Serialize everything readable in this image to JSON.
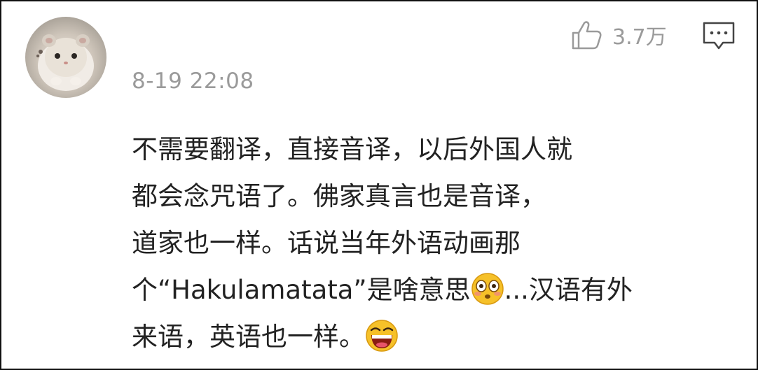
{
  "comment": {
    "timestamp": "8-19 22:08",
    "like_count": "3.7万",
    "icons": {
      "like": "thumbs-up-icon",
      "reply": "comment-bubble-icon",
      "avatar": "hamster-avatar"
    },
    "content_lines": [
      {
        "text": "不需要翻译，直接音译，以后外国人就"
      },
      {
        "text": "都会念咒语了。佛家真言也是音译，"
      },
      {
        "text": "道家也一样。话说当年外语动画那"
      },
      {
        "text_before": "个“Hakulamatata”是啥意思",
        "emoji": "flushed-face-emoji",
        "text_after": "...汉语有外"
      },
      {
        "text_before": "来语，英语也一样。",
        "emoji": "laughing-face-emoji"
      }
    ]
  },
  "colors": {
    "text": "#222222",
    "meta_gray": "#9a9a9a",
    "border": "#111111",
    "emoji_yellow": "#f6c129"
  }
}
